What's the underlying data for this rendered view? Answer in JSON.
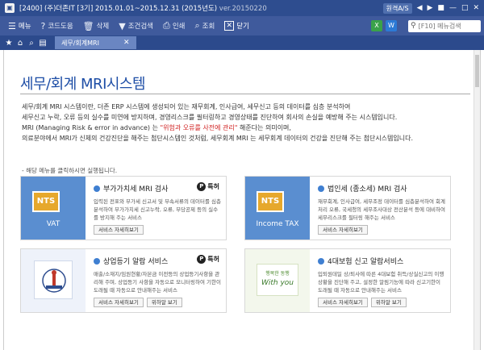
{
  "titlebar": {
    "icon": "app-icon",
    "title": "[2400] (주)더존IT  [3기] 2015.01.01~2015.12.31 (2015년도)",
    "subtitle": "ver.20150220",
    "pill": "원격A/S",
    "controls": [
      "◀",
      "▶",
      "■",
      "—",
      "□",
      "✕"
    ]
  },
  "toolbar": {
    "items": [
      {
        "icon": "menu-icon",
        "label": "메뉴"
      },
      {
        "icon": "help-icon",
        "label": "코드도움"
      },
      {
        "icon": "delete-icon",
        "label": "삭제"
      },
      {
        "icon": "filter-icon",
        "label": "조건검색"
      },
      {
        "icon": "print-icon",
        "label": "인쇄"
      },
      {
        "icon": "view-icon",
        "label": "조회"
      },
      {
        "icon": "close-icon",
        "label": "닫기"
      }
    ],
    "search_placeholder": "[F10] 메뉴검색"
  },
  "tabbar": {
    "tab_label": "세무/회계MRI",
    "tab_close": "✕"
  },
  "page": {
    "title": "세무/회계 MRI시스템",
    "desc_1": "세무/회계 MRI 시스템이란, 더존 ERP 시스템에 생성되어 있는 재무회계, 인사급여, 세무신고 등의 데이터를 심층 분석하여",
    "desc_2": "세무신고 누락, 오류 등의 실수를 미연에 방지하며, 경영리스크를 필터링하고 경영상태를 진단하여 회사의 손실을 예방해 주는 시스템입니다.",
    "desc_3a": "MRI (Managing Risk & error in advance) 는",
    "desc_3b": "\"위험과 오류를 사전에 관리\"",
    "desc_3c": "해준다는 의미이며,",
    "desc_4": "의료분야에서 MRI가 신체의 건강진단을 해주는 첨단시스템인 것처럼, 세무회계 MRI 는 세무회계 데이터의 건강을 진단해 주는 첨단시스템입니다.",
    "hint": "- 해당 메뉴를 클릭하시면 실행됩니다."
  },
  "cards": [
    {
      "thumb_logo": "NTS",
      "thumb_caption": "VAT",
      "title": "부가가치세 MRI 검사",
      "patent": "특허",
      "desc": "입력된 전표와 부가세 신고서 및 부속서류의 데이터를 심층분석하여 부가가치세 신고누락, 오류, 부당공제 등의 실수를 방지해 주는 서비스",
      "buttons": [
        "서비스 자세히보기"
      ]
    },
    {
      "thumb_logo": "NTS",
      "thumb_caption": "Income TAX",
      "title": "법인세 (종소세) MRI 검사",
      "desc": "재무회계, 인사급여, 세무조정 데이터를 심층분석하여 회계처리 오류, 국세청의 세무조사대상 전산분석 등에 대비하여 세무리스크를 필터링 해주는 서비스",
      "buttons": [
        "서비스 자세히보기"
      ]
    },
    {
      "title": "상업등기 알람 서비스",
      "patent": "특허",
      "desc": "매출/소재지/임원현황/자본금 이전등의 상업등기사항을 관리해 주며, 상업등기 사항을 자동으로 모니터링하여 기한이 도래될 때 자동으로 안내해주는 서비스",
      "buttons": [
        "서비스 자세히보기",
        "위하알 보기"
      ]
    },
    {
      "thumb_l1": "행복한 동행",
      "thumb_l2": "With you",
      "title": "4대보험 신고 알람서비스",
      "desc": "입퇴원데일 상/퇴사에 따른 4대보험 취득/상실신고의 이행상황을 진단해 주고, 설정한 알림기능에 따라 신고기한이 도래될 때 자동으로 안내해주는 서비스",
      "buttons": [
        "서비스 자세히보기",
        "위하알 보기"
      ]
    }
  ]
}
